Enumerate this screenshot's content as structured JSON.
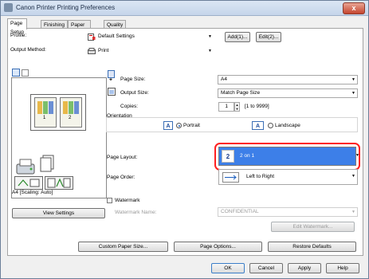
{
  "window": {
    "title": "Canon Printer Printing Preferences",
    "close_label": "x"
  },
  "tabs": [
    "Page Setup",
    "Finishing",
    "Paper Source",
    "Quality"
  ],
  "profile": {
    "label": "Profile:",
    "value": "Default Settings",
    "add_label": "Add(1)...",
    "edit_label": "Edit(2)..."
  },
  "output_method": {
    "label": "Output Method:",
    "value": "Print"
  },
  "preview": {
    "caption": "A4 [Scaling: Auto]",
    "page_numbers": [
      "1",
      "2"
    ],
    "view_settings_label": "View Settings"
  },
  "page_size": {
    "label": "Page Size:",
    "value": "A4"
  },
  "output_size": {
    "label": "Output Size:",
    "value": "Match Page Size"
  },
  "copies": {
    "label": "Copies:",
    "value": "1",
    "range": "[1 to 9999]"
  },
  "orientation": {
    "label": "Orientation",
    "portrait_label": "Portrait",
    "landscape_label": "Landscape",
    "selected": "portrait",
    "portrait_glyph": "A",
    "landscape_glyph": "A"
  },
  "page_layout": {
    "label": "Page Layout:",
    "value": "2 on 1",
    "glyph": "2"
  },
  "page_order": {
    "label": "Page Order:",
    "value": "Left to Right"
  },
  "watermark": {
    "label": "Watermark",
    "name_label": "Watermark Name:",
    "name_value": "CONFIDENTIAL",
    "edit_label": "Edit Watermark..."
  },
  "bottom_buttons": {
    "custom_paper_size": "Custom Paper Size...",
    "page_options": "Page Options...",
    "restore_defaults": "Restore Defaults"
  },
  "dialog_buttons": {
    "ok": "OK",
    "cancel": "Cancel",
    "apply": "Apply",
    "help": "Help"
  },
  "colors": {
    "highlight": "#3d7fe8",
    "highlight_border": "#ff1f1f",
    "titlebar": "#c5d5ea",
    "close": "#c4442e"
  }
}
